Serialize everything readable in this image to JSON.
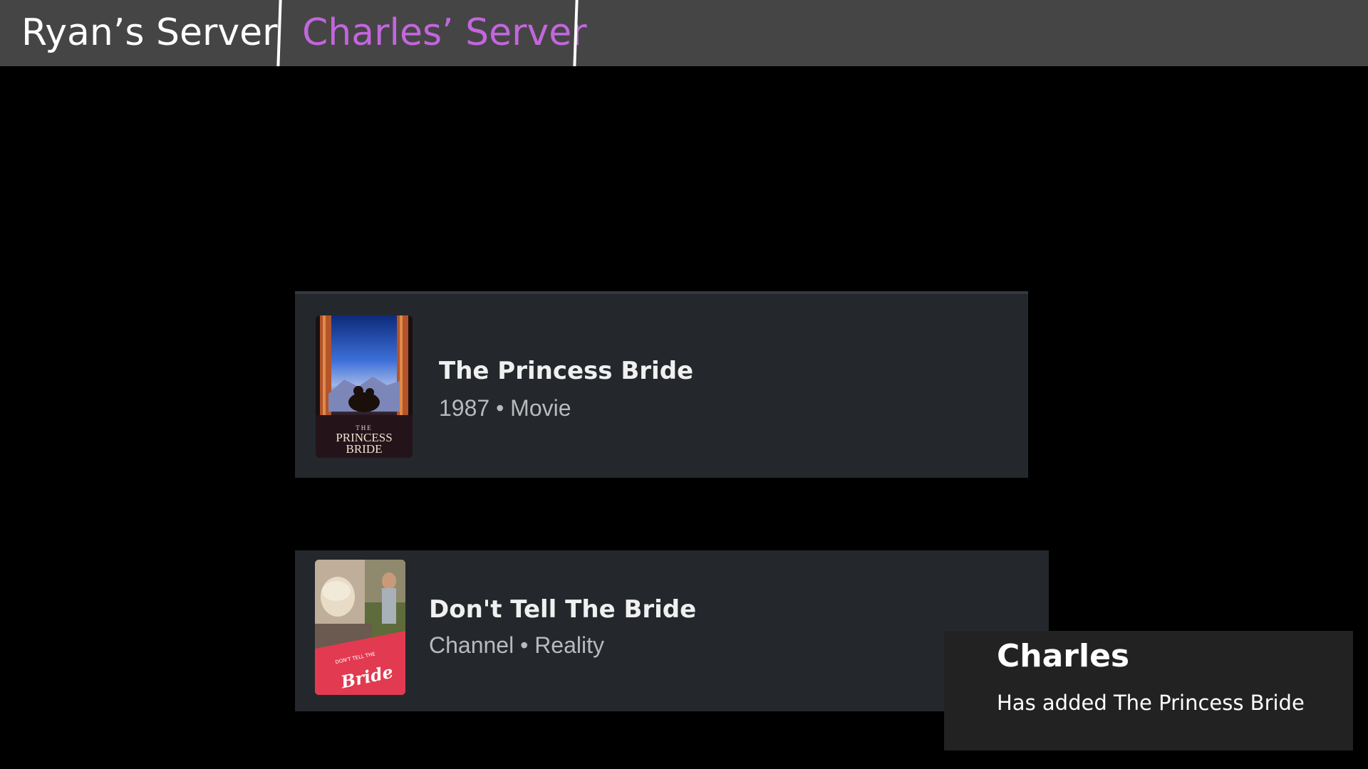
{
  "tabs": {
    "ryan_label": "Ryan’s Server",
    "charles_label": "Charles’ Server",
    "active_tab": "charles",
    "active_color": "#c366de"
  },
  "results": [
    {
      "title": "The Princess Bride",
      "subtitle": "1987 • Movie",
      "poster_text": "PRINCESS BRIDE",
      "poster_small": "THE",
      "icon": "princess-bride-poster"
    },
    {
      "title": "Don't Tell The Bride",
      "subtitle": "Channel • Reality",
      "poster_text": "Bride",
      "poster_small": "DON'T TELL THE",
      "icon": "dont-tell-the-bride-poster"
    }
  ],
  "notification": {
    "name": "Charles",
    "message": "Has added The Princess Bride"
  }
}
